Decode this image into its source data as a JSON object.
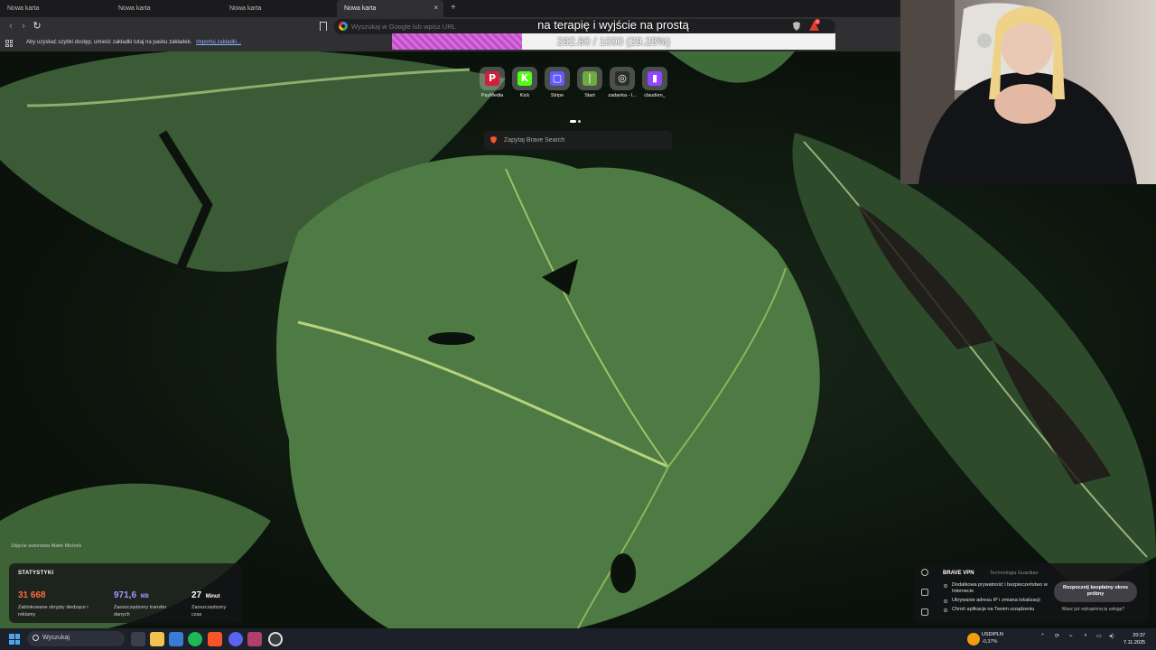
{
  "browser": {
    "tabs": [
      {
        "label": "Nowa karta"
      },
      {
        "label": "Nowa karta"
      },
      {
        "label": "Nowa karta"
      },
      {
        "label": "Nowa karta"
      }
    ],
    "new_tab_glyph": "+",
    "close_glyph": "×",
    "omnibox_placeholder": "Wyszukaj w Google lub wpisz URL",
    "bookmark_bar_text": "Aby uzyskać szybki dostęp, umieść zakładki tutaj na pasku zakładek.",
    "bookmark_bar_link": "Importuj zakładki...",
    "rewards_badge": "4"
  },
  "overlay": {
    "title": "na terapię i wyjście na prostą",
    "progress_text": "292.80 / 1000 (29.28%)",
    "progress_fraction": 0.2928
  },
  "new_tab": {
    "top_sites": [
      {
        "label": "PayMedia",
        "icon": "paymedia-icon",
        "glyph": "P",
        "color": "#d11f3c"
      },
      {
        "label": "Kick",
        "icon": "kick-icon",
        "glyph": "K",
        "color": "#53fc18"
      },
      {
        "label": "Stripe",
        "icon": "stripe-icon",
        "glyph": "▢",
        "color": "#635bff"
      },
      {
        "label": "Start",
        "icon": "start-icon",
        "glyph": "❘",
        "color": "#6dab3c"
      },
      {
        "label": "zadanka - l...",
        "icon": "zadanka-icon",
        "glyph": "◎",
        "color": "#2d2d2d"
      },
      {
        "label": "claudien_",
        "icon": "twitch-icon",
        "glyph": "▮",
        "color": "#9146ff"
      }
    ],
    "search_placeholder": "Zapytaj Brave Search",
    "photo_credit": "Zdjęcie autorstwa Maite Michels"
  },
  "stats": {
    "title": "STATYSTYKI",
    "items": [
      {
        "value": "31 668",
        "unit": "",
        "desc": "Zablokowane skrypty śledzące i reklamy",
        "color": "#ff6a3d"
      },
      {
        "value": "971,6",
        "unit": "MB",
        "desc": "Zaoszczędzony transfer danych",
        "color": "#a992ff"
      },
      {
        "value": "27",
        "unit": "Minut",
        "desc": "Zaoszczędzony czas",
        "color": "#ffffff"
      }
    ]
  },
  "vpn": {
    "title": "BRAVE VPN",
    "tech": "Technologia  Guardian",
    "features": [
      "Dodatkowa prywatność i bezpieczeństwo w Internecie",
      "Ukrywanie adresu IP i zmiana lokalizacji",
      "Chroń aplikacje na Twoim urządzeniu"
    ],
    "cta": "Rozpocznij bezpłatny okres próbny",
    "link": "Masz już wykupioną tę usługę?"
  },
  "taskbar": {
    "search_label": "Wyszukaj",
    "currency": "USD/PLN",
    "currency_change": "-0,37%",
    "time": "20:37",
    "date": "7.11.2025"
  }
}
